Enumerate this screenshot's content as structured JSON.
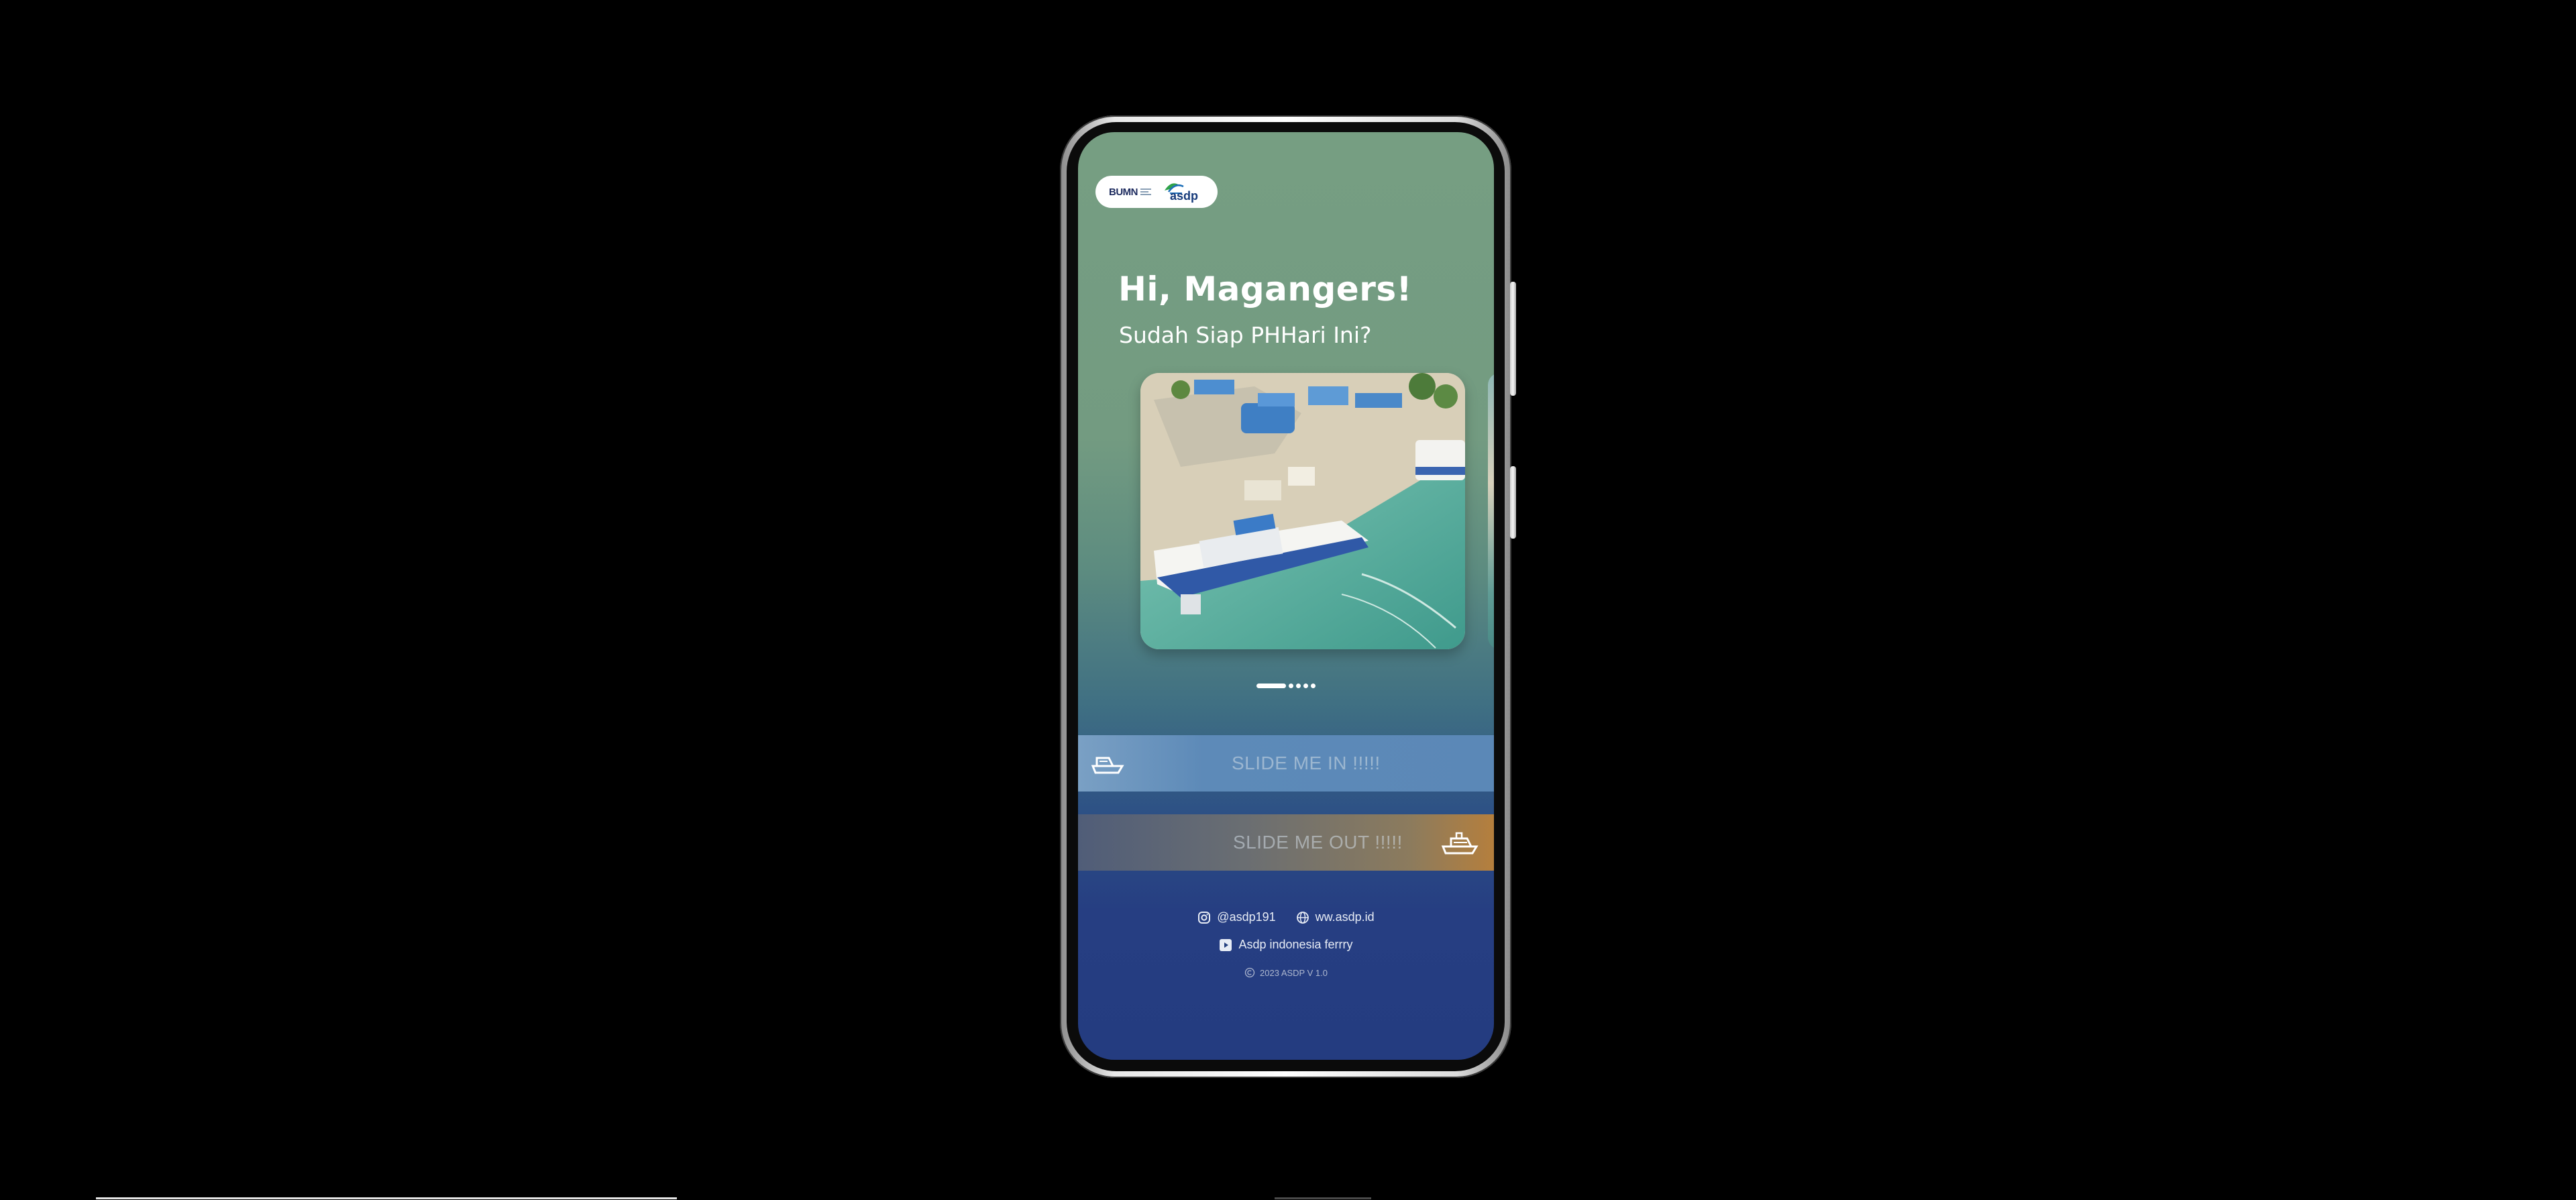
{
  "header": {
    "logo_bumn_text": "BUMN",
    "logo_asdp_text": "asdp"
  },
  "greeting": {
    "title": "Hi, Magangers!",
    "subtitle": "Sudah Siap PHHari Ini?"
  },
  "carousel": {
    "slide_count": 5,
    "active_index": 0,
    "image_subject": "aerial view of ferry at harbour"
  },
  "actions": {
    "slide_in_label": "SLIDE ME IN !!!!!",
    "slide_out_label": "SLIDE ME OUT !!!!!",
    "slide_in_icon": "ferry-icon",
    "slide_out_icon": "ship-icon"
  },
  "footer": {
    "instagram": "@asdp191",
    "website": "ww.asdp.id",
    "youtube": "Asdp indonesia ferrry",
    "copyright": "2023 ASDP V 1.0"
  },
  "colors": {
    "screen_top": "#769e82",
    "screen_bottom": "#243c80",
    "slide_in_bar": "#5b88b7",
    "slide_out_bar_end": "#b57f3d"
  }
}
